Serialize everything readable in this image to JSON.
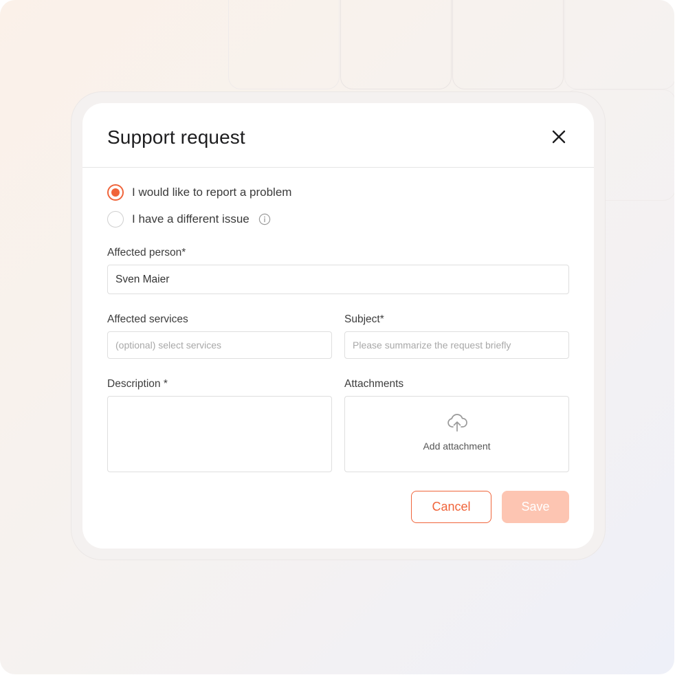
{
  "dialog": {
    "title": "Support request",
    "close_icon": "close-icon"
  },
  "request_type": {
    "options": [
      {
        "label": "I would like to report a problem",
        "selected": true
      },
      {
        "label": "I have a different issue",
        "selected": false,
        "icon": "info-icon"
      }
    ]
  },
  "form": {
    "affected_person": {
      "label": "Affected person*",
      "value": "Sven Maier"
    },
    "affected_services": {
      "label": "Affected services",
      "value": "",
      "placeholder": "(optional) select services"
    },
    "subject": {
      "label": "Subject*",
      "value": "",
      "placeholder": "Please summarize the request briefly"
    },
    "description": {
      "label": "Description *",
      "value": ""
    },
    "attachments": {
      "label": "Attachments",
      "button_label": "Add attachment",
      "icon": "cloud-upload-icon"
    }
  },
  "actions": {
    "cancel_label": "Cancel",
    "save_label": "Save"
  },
  "colors": {
    "accent": "#f0643a",
    "save_disabled": "#fdc5b2"
  }
}
